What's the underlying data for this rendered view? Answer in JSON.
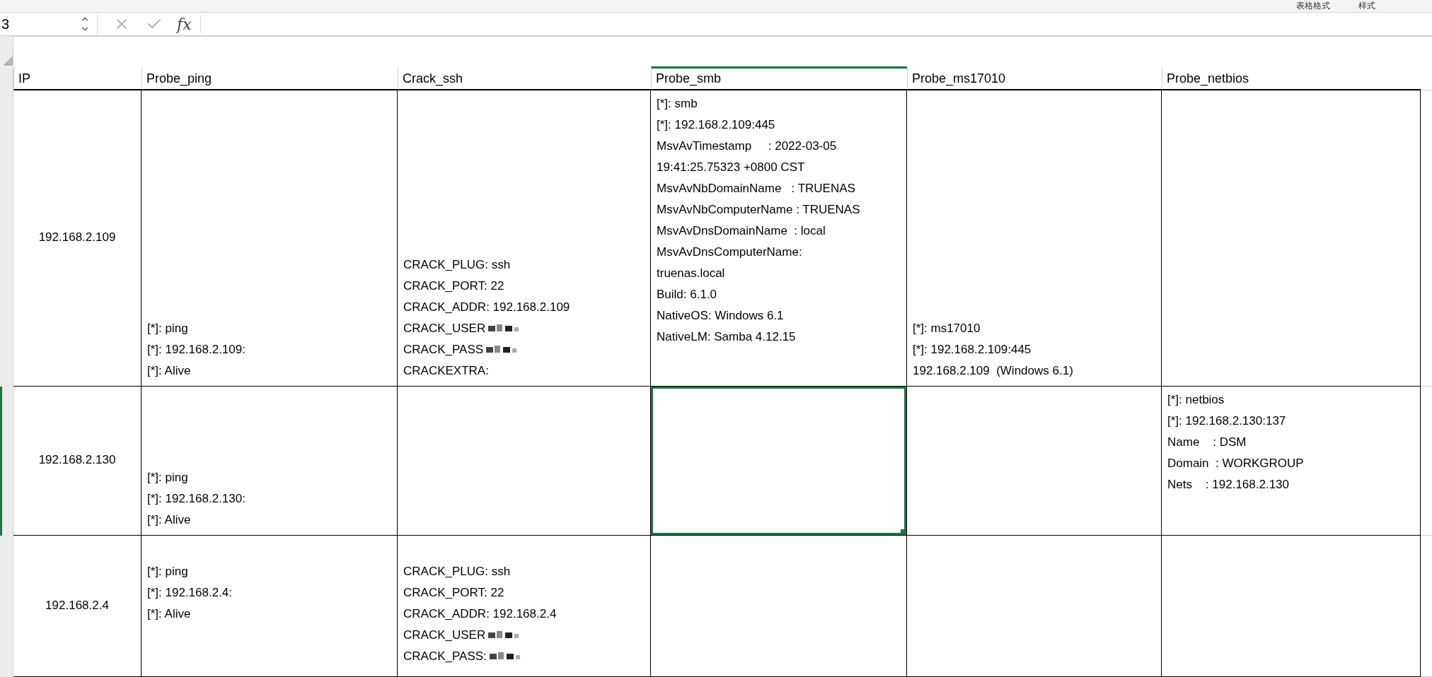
{
  "ribbon": {
    "labels": [
      "表格格式",
      "样式"
    ]
  },
  "formula_bar": {
    "name_box": "3",
    "function_label": "fx"
  },
  "sheet": {
    "columns": [
      {
        "label": "IP",
        "selected": false
      },
      {
        "label": "Probe_ping",
        "selected": false
      },
      {
        "label": "Crack_ssh",
        "selected": false
      },
      {
        "label": "Probe_smb",
        "selected": true
      },
      {
        "label": "Probe_ms17010",
        "selected": false
      },
      {
        "label": "Probe_netbios",
        "selected": false
      }
    ],
    "rows": [
      {
        "selected": false,
        "cells": [
          {
            "selected": false,
            "lines": [
              "192.168.2.109"
            ]
          },
          {
            "selected": false,
            "lines": [
              "[*]: ping",
              "[*]: 192.168.2.109:",
              "[*]: Alive"
            ]
          },
          {
            "selected": false,
            "lines": [
              "CRACK_PLUG: ssh",
              "CRACK_PORT: 22",
              "CRACK_ADDR: 192.168.2.109",
              {
                "text": "CRACK_USER",
                "redacted": true
              },
              {
                "text": "CRACK_PASS",
                "redacted": true
              },
              "CRACKEXTRA:"
            ]
          },
          {
            "selected": false,
            "lines": [
              "[*]: smb",
              "[*]: 192.168.2.109:445",
              "MsvAvTimestamp     : 2022-03-05",
              "19:41:25.75323 +0800 CST",
              "MsvAvNbDomainName   : TRUENAS",
              "MsvAvNbComputerName : TRUENAS",
              "MsvAvDnsDomainName  : local",
              "MsvAvDnsComputerName:",
              "truenas.local",
              "Build: 6.1.0",
              "NativeOS: Windows 6.1",
              "NativeLM: Samba 4.12.15"
            ]
          },
          {
            "selected": false,
            "lines": [
              "[*]: ms17010",
              "[*]: 192.168.2.109:445",
              "192.168.2.109  (Windows 6.1)"
            ]
          },
          {
            "selected": false
          }
        ]
      },
      {
        "selected": true,
        "cells": [
          {
            "selected": false,
            "lines": [
              "192.168.2.130"
            ]
          },
          {
            "selected": false,
            "lines": [
              "[*]: ping",
              "[*]: 192.168.2.130:",
              "[*]: Alive"
            ]
          },
          {
            "selected": false
          },
          {
            "selected": true
          },
          {
            "selected": false
          },
          {
            "selected": false,
            "lines": [
              "[*]: netbios",
              "[*]: 192.168.2.130:137",
              "Name    : DSM",
              "Domain  : WORKGROUP",
              "Nets    : 192.168.2.130"
            ]
          }
        ]
      },
      {
        "selected": false,
        "cells": [
          {
            "selected": false,
            "lines": [
              "192.168.2.4"
            ]
          },
          {
            "selected": false,
            "lines": [
              "[*]: ping",
              "[*]: 192.168.2.4:",
              "[*]: Alive"
            ]
          },
          {
            "selected": false,
            "lines": [
              "CRACK_PLUG: ssh",
              "CRACK_PORT: 22",
              "CRACK_ADDR: 192.168.2.4",
              {
                "text": "CRACK_USER",
                "redacted": true
              },
              {
                "text": "CRACK_PASS:",
                "redacted": true
              }
            ]
          },
          {
            "selected": false
          },
          {
            "selected": false
          },
          {
            "selected": false
          }
        ]
      }
    ]
  }
}
